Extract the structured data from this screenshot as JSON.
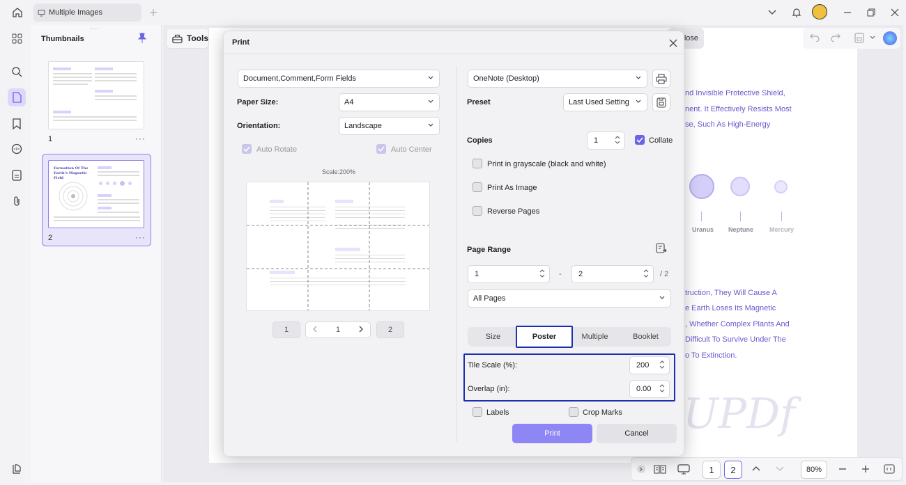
{
  "titlebar": {
    "tab_label": "Multiple Images"
  },
  "thumbnails": {
    "title": "Thumbnails",
    "pages": [
      {
        "num": "1",
        "more": "···"
      },
      {
        "num": "2",
        "more": "···",
        "heading": "Formation Of The Earth's Magnetic Field"
      }
    ]
  },
  "toolbar": {
    "tools_label": "Tools",
    "close_label": "lose"
  },
  "document": {
    "lines": [
      "nd Invisible Protective Shield,",
      "nent. It Effectively Resists Most",
      "se, Such As High-Energy",
      "truction, They Will Cause A",
      "e Earth Loses Its Magnetic",
      ", Whether Complex Plants And",
      "Difficult To Survive Under The",
      "o To Extinction."
    ],
    "planets": [
      "Uranus",
      "Neptune",
      "Mercury"
    ],
    "watermark": "UPDf"
  },
  "bottombar": {
    "page1": "1",
    "page2": "2",
    "zoom": "80%"
  },
  "print": {
    "title": "Print",
    "content_select": "Document,Comment,Form Fields",
    "paper_size_label": "Paper Size:",
    "paper_size": "A4",
    "orientation_label": "Orientation:",
    "orientation": "Landscape",
    "auto_rotate": "Auto Rotate",
    "auto_center": "Auto Center",
    "scale_text": "Scale:200%",
    "preview_nav": {
      "first": "1",
      "current": "1",
      "last": "2"
    },
    "printer": "OneNote (Desktop)",
    "preset_label": "Preset",
    "preset": "Last Used Setting",
    "copies_label": "Copies",
    "copies": "1",
    "collate": "Collate",
    "grayscale": "Print in grayscale (black and white)",
    "as_image": "Print As Image",
    "reverse": "Reverse Pages",
    "page_range_label": "Page Range",
    "range_from": "1",
    "range_sep": "-",
    "range_to": "2",
    "range_total": "/ 2",
    "pages_select": "All Pages",
    "modes": [
      "Size",
      "Poster",
      "Multiple",
      "Booklet"
    ],
    "active_mode": "Poster",
    "tile_scale_label": "Tile Scale (%):",
    "tile_scale": "200",
    "overlap_label": "Overlap (in):",
    "overlap": "0.00",
    "labels": "Labels",
    "crop_marks": "Crop Marks",
    "print_btn": "Print",
    "cancel_btn": "Cancel"
  },
  "colors": {
    "accent": "#6c63e6",
    "highlight": "#1b2fb0",
    "print_button": "#8f86f5"
  }
}
